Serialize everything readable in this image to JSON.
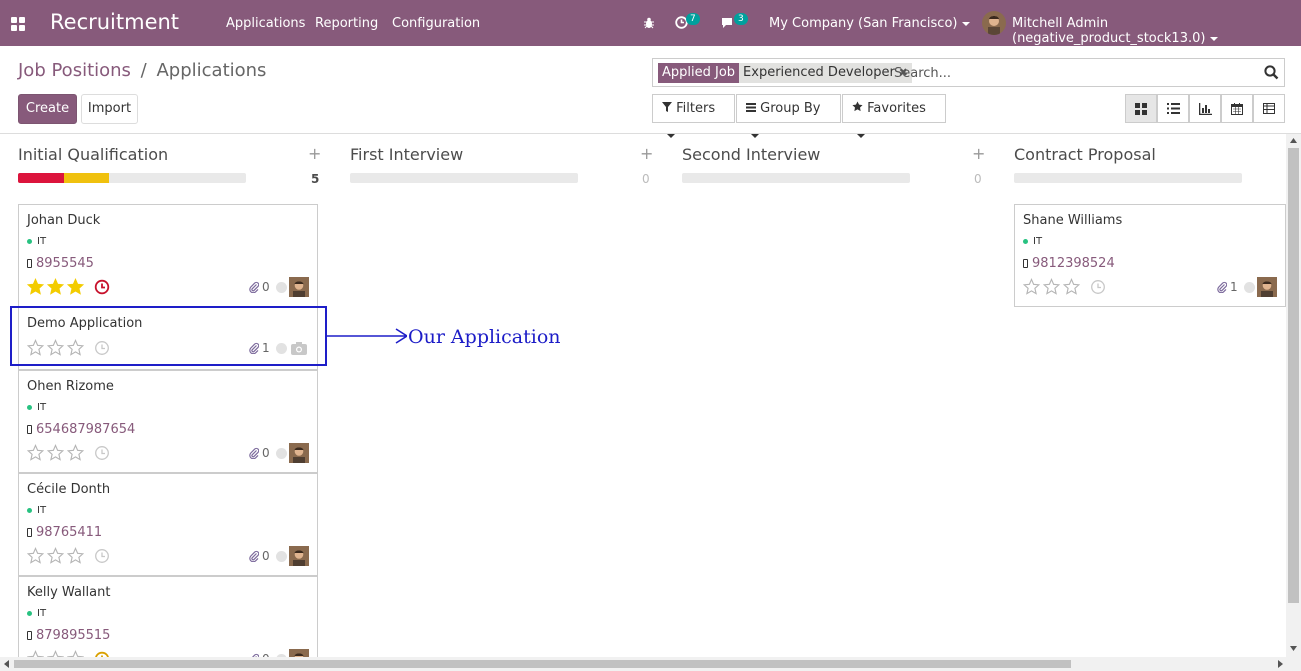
{
  "navbar": {
    "app_name": "Recruitment",
    "menu": [
      "Applications",
      "Reporting",
      "Configuration"
    ],
    "activity_count": "7",
    "message_count": "3",
    "company": "My Company (San Francisco)",
    "user": "Mitchell Admin (negative_product_stock13.0)",
    "bar_color": "#875a7b"
  },
  "breadcrumb": {
    "parent": "Job Positions",
    "separator": "/",
    "current": "Applications"
  },
  "buttons": {
    "create": "Create",
    "import": "Import"
  },
  "search": {
    "facet_key": "Applied Job",
    "facet_value": "Experienced Developer",
    "placeholder": "Search..."
  },
  "filters": {
    "filters": "Filters",
    "group_by": "Group By",
    "favorites": "Favorites"
  },
  "views": [
    "kanban-icon",
    "list-icon",
    "graph-icon",
    "calendar-icon",
    "pivot-icon"
  ],
  "columns": [
    {
      "title": "Initial Qualification",
      "count": "5",
      "progress": [
        {
          "color": "#dc143c",
          "fraction": 0.2
        },
        {
          "color": "#f0c10e",
          "fraction": 0.2
        }
      ],
      "cards": [
        {
          "name": "Johan Duck",
          "tag": "IT",
          "phone": "8955545",
          "stars": 3,
          "clock": "overdue",
          "attachments": "0"
        },
        {
          "name": "Demo Application",
          "tag": "",
          "phone": "",
          "stars": 0,
          "clock": "none",
          "attachments": "1"
        },
        {
          "name": "Ohen Rizome",
          "tag": "IT",
          "phone": "654687987654",
          "stars": 0,
          "clock": "none",
          "attachments": "0"
        },
        {
          "name": "Cécile Donth",
          "tag": "IT",
          "phone": "98765411",
          "stars": 0,
          "clock": "none",
          "attachments": "0"
        },
        {
          "name": "Kelly Wallant",
          "tag": "IT",
          "phone": "879895515",
          "stars": 0,
          "clock": "warning",
          "attachments": "0"
        }
      ]
    },
    {
      "title": "First Interview",
      "count": "0",
      "cards": []
    },
    {
      "title": "Second Interview",
      "count": "0",
      "cards": []
    },
    {
      "title": "Contract Proposal",
      "count": "",
      "cards": [
        {
          "name": "Shane Williams",
          "tag": "IT",
          "phone": "9812398524",
          "stars": 0,
          "clock": "none",
          "attachments": "1"
        }
      ]
    }
  ],
  "annotation": "Our  Application",
  "colors": {
    "primary": "#875a7b",
    "star_active": "#f3cc00",
    "overdue": "#d9534f",
    "annotation": "#1c1cc7"
  }
}
